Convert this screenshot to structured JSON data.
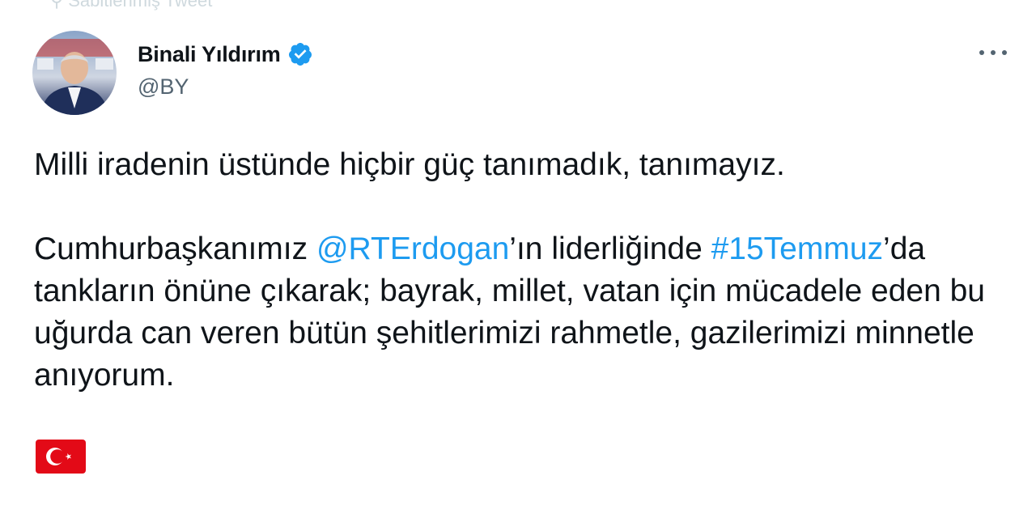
{
  "context": {
    "text": "Sabitlenmiş Tweet"
  },
  "author": {
    "name": "Binali Yıldırım",
    "handle": "@BY",
    "verified": true
  },
  "tweet": {
    "paragraph1": "Milli iradenin üstünde hiçbir güç tanımadık, tanımayız.",
    "p2_intro": "Cumhurbaşkanımız ",
    "mention": "@RTErdogan",
    "p2_after_mention": "’ın liderliğinde ",
    "hashtag": "#15Temmuz",
    "p2_rest": "’da tankların önüne çıkarak; bayrak, millet, vatan için mücadele eden bu uğurda can veren bütün şehitlerimizi rahmetle, gazilerimizi minnetle anıyorum.",
    "emoji": "turkey-flag-icon"
  },
  "colors": {
    "link": "#1d9bf0",
    "text": "#0f1419",
    "secondary": "#536471",
    "verified": "#1d9bf0",
    "flag_red": "#e30a17"
  }
}
